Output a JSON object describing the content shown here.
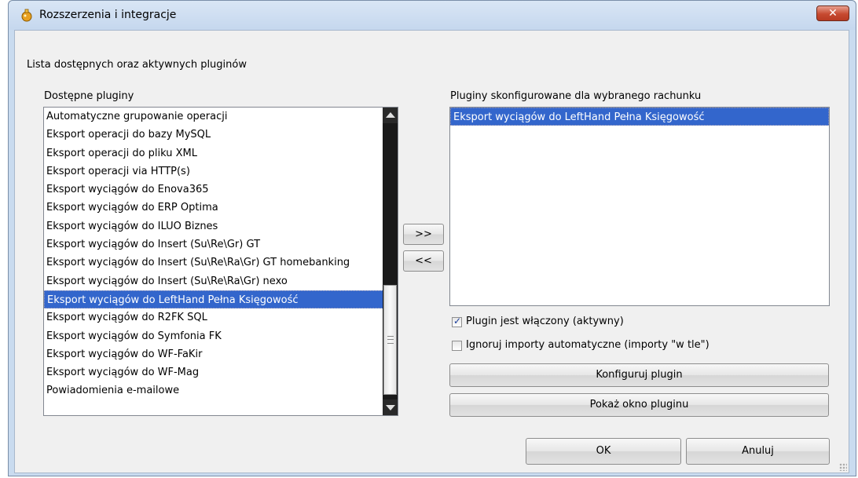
{
  "window": {
    "title": "Rozszerzenia i integracje",
    "close_label": "✕",
    "accent_color": "#3366cc"
  },
  "header": {
    "subtitle": "Lista dostępnych oraz aktywnych pluginów"
  },
  "available": {
    "label": "Dostępne pluginy",
    "items": [
      "Automatyczne grupowanie operacji",
      "Eksport operacji do bazy MySQL",
      "Eksport operacji do pliku XML",
      "Eksport operacji via HTTP(s)",
      "Eksport wyciągów do Enova365",
      "Eksport wyciągów do ERP Optima",
      "Eksport wyciągów do ILUO Biznes",
      "Eksport wyciągów do Insert (Su\\Re\\Gr) GT",
      "Eksport wyciągów do Insert (Su\\Re\\Ra\\Gr) GT homebanking",
      "Eksport wyciągów do Insert (Su\\Re\\Ra\\Gr) nexo",
      "Eksport wyciągów do LeftHand Pełna Księgowość",
      "Eksport wyciągów do R2FK SQL",
      "Eksport wyciągów do Symfonia FK",
      "Eksport wyciągów do WF-FaKir",
      "Eksport wyciągów do WF-Mag",
      "Powiadomienia e-mailowe"
    ],
    "selected_index": 10
  },
  "transfer": {
    "add_label": ">>",
    "remove_label": "<<"
  },
  "configured": {
    "label": "Pluginy skonfigurowane dla wybranego rachunku",
    "items": [
      "Eksport wyciągów do LeftHand Pełna Księgowość"
    ],
    "selected_index": 0
  },
  "options": {
    "enabled_label": "Plugin jest włączony (aktywny)",
    "enabled_checked": true,
    "ignore_label": "Ignoruj importy automatyczne (importy \"w tle\")",
    "ignore_checked": false
  },
  "actions": {
    "configure_label": "Konfiguruj plugin",
    "show_window_label": "Pokaż okno pluginu",
    "ok_label": "OK",
    "cancel_label": "Anuluj"
  }
}
